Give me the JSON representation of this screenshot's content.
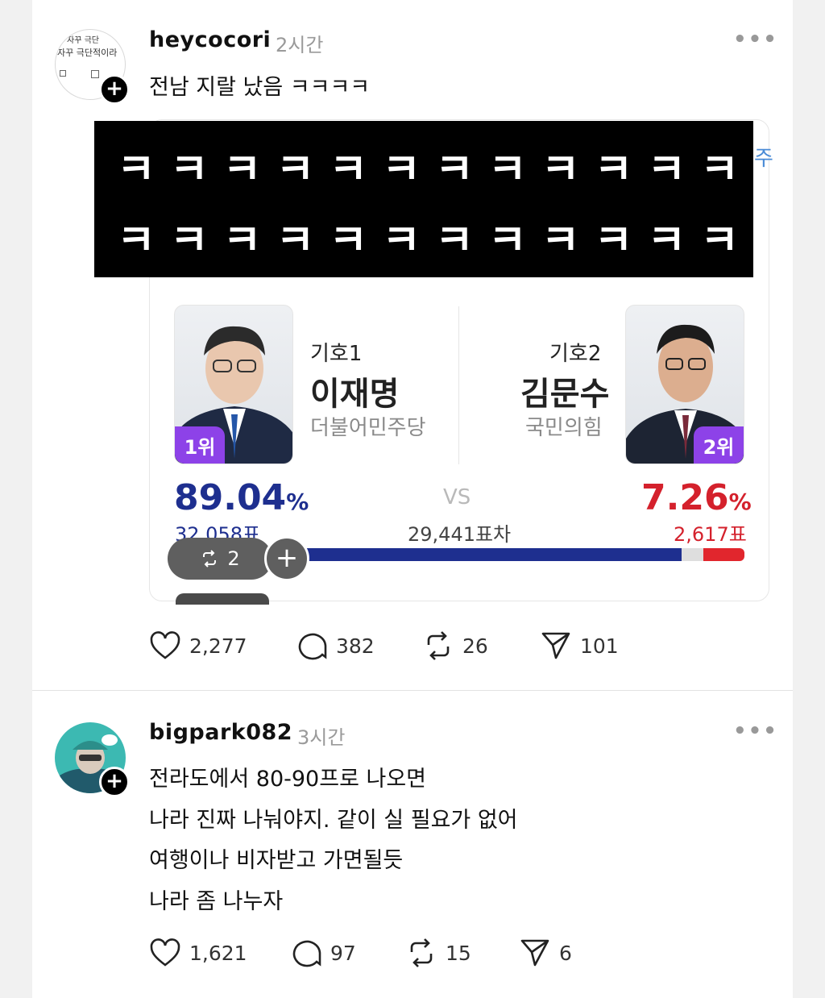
{
  "post1": {
    "username": "heycocori",
    "time": "2시간",
    "text": "전남 지랄 났음 ㅋㅋㅋㅋ",
    "avatar_lines": [
      "자꾸 극단",
      "자꾸 극단적이라"
    ],
    "black_overlay": {
      "row1": "ㅋㅋㅋㅋㅋㅋㅋㅋㅋㅋㅋㅋ",
      "row2": "ㅋㅋㅋㅋㅋㅋㅋㅋㅋㅋㅋㅋ",
      "side_char": "주"
    },
    "election": {
      "candidate1": {
        "number": "기호1",
        "name": "이재명",
        "party": "더불어민주당",
        "rank": "1위",
        "percent": "89.04",
        "percent_unit": "%",
        "votes": "32,058표",
        "color": "#1e2f8f",
        "rank_color": "#8d42e8"
      },
      "candidate2": {
        "number": "기호2",
        "name": "김문수",
        "party": "국민의힘",
        "rank": "2위",
        "percent": "7.26",
        "percent_unit": "%",
        "votes": "2,617표",
        "color": "#d4212c",
        "rank_color": "#8d42e8"
      },
      "vs": "VS",
      "difference": "29,441표차",
      "bar_shares": {
        "candidate1": 89.04,
        "other": 3.7,
        "candidate2": 7.26
      },
      "repost_pill_count": "2"
    },
    "actions": {
      "likes": "2,277",
      "comments": "382",
      "reposts": "26",
      "shares": "101"
    }
  },
  "post2": {
    "username": "bigpark082",
    "time": "3시간",
    "lines": [
      "전라도에서 80-90프로 나오면",
      "나라 진짜 나눠야지. 같이 실 필요가 없어",
      "여행이나 비자받고 가면될듯",
      "나라 좀 나누자"
    ],
    "actions": {
      "likes": "1,621",
      "comments": "97",
      "reposts": "15",
      "shares": "6"
    }
  },
  "icons": [
    "heart-icon",
    "comment-icon",
    "repost-icon",
    "share-icon",
    "more-icon",
    "plus-icon"
  ]
}
